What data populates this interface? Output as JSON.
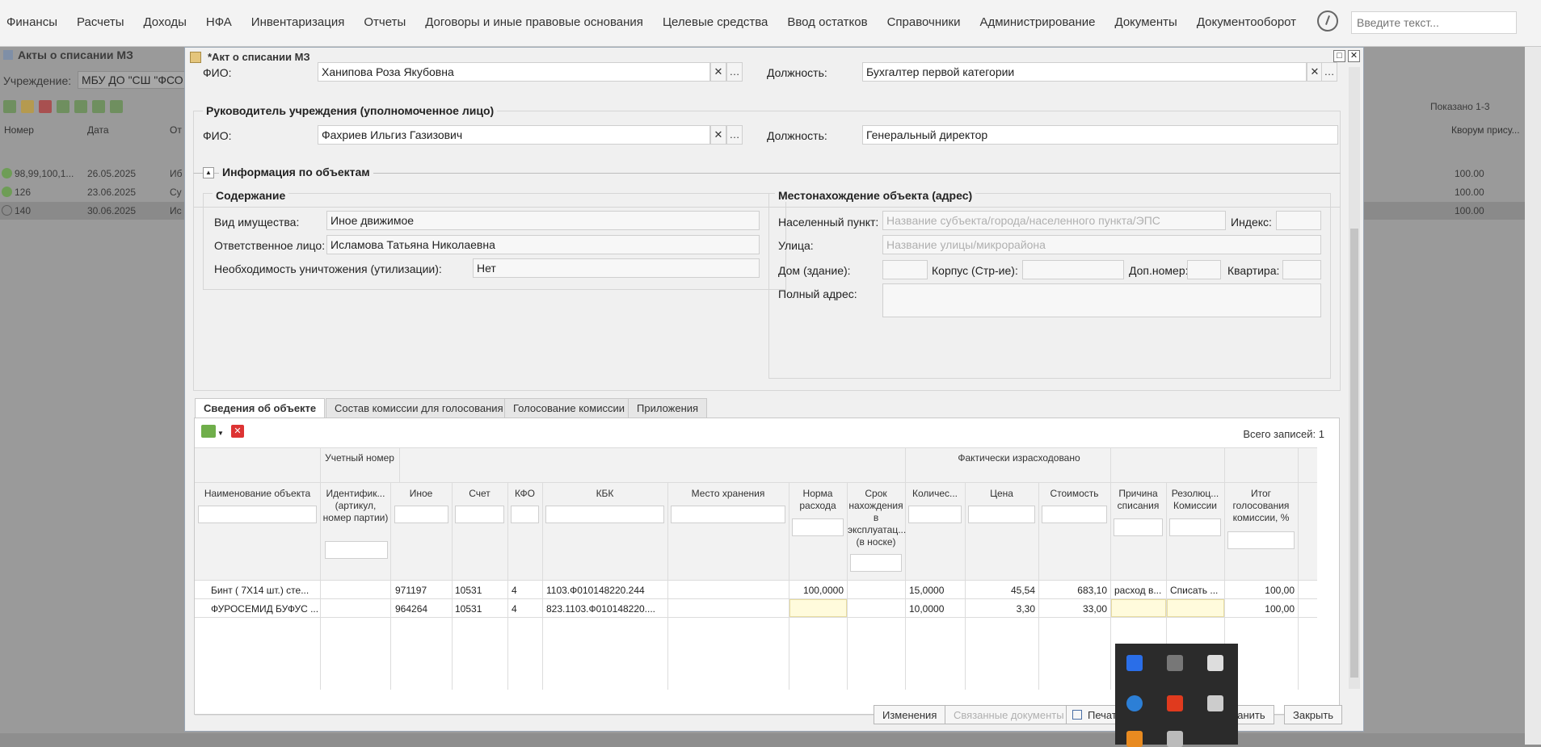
{
  "menu": {
    "items": [
      "Финансы",
      "Расчеты",
      "Доходы",
      "НФА",
      "Инвентаризация",
      "Отчеты",
      "Договоры и иные правовые основания",
      "Целевые средства",
      "Ввод остатков",
      "Справочники",
      "Администрирование",
      "Документы",
      "Документооборот"
    ],
    "search_placeholder": "Введите текст..."
  },
  "background_list": {
    "title": "Акты о списании МЗ",
    "org_label": "Учреждение:",
    "org_value": "МБУ ДО \"СШ \"ФСО \"",
    "shown": "Показано 1-3",
    "columns": [
      "Номер",
      "Дата",
      "От",
      "Кворум прису..."
    ],
    "rows": [
      {
        "number": "98,99,100,1...",
        "date": "26.05.2025",
        "from": "Иб",
        "quorum": "100.00"
      },
      {
        "number": "126",
        "date": "23.06.2025",
        "from": "Су",
        "quorum": "100.00"
      },
      {
        "number": "140",
        "date": "30.06.2025",
        "from": "Ис",
        "quorum": "100.00"
      }
    ]
  },
  "modal": {
    "title": "*Акт о списании МЗ",
    "accountant": {
      "fio_label": "ФИО:",
      "fio_value": "Ханипова Роза Якубовна",
      "position_label": "Должность:",
      "position_value": "Бухгалтер первой категории"
    },
    "head": {
      "group_label": "Руководитель учреждения (уполномоченное лицо)",
      "fio_label": "ФИО:",
      "fio_value": "Фахриев Ильгиз Газизович",
      "position_label": "Должность:",
      "position_value": "Генеральный директор"
    },
    "objects_section": {
      "title": "Информация по объектам",
      "content_title": "Содержание",
      "property_type_label": "Вид имущества:",
      "property_type_value": "Иное движимое",
      "responsible_label": "Ответственное лицо:",
      "responsible_value": "Исламова Татьяна Николаевна",
      "disposal_label": "Необходимость уничтожения (утилизации):",
      "disposal_value": "Нет",
      "location_title": "Местонахождение объекта (адрес)",
      "locality_label": "Населенный пункт:",
      "locality_placeholder": "Название субъекта/города/населенного пункта/ЭПС",
      "index_label": "Индекс:",
      "street_label": "Улица:",
      "street_placeholder": "Название улицы/микрорайона",
      "house_label": "Дом (здание):",
      "building_label": "Корпус (Стр-ие):",
      "extra_label": "Доп.номер:",
      "flat_label": "Квартира:",
      "full_address_label": "Полный адрес:"
    },
    "tabs": [
      "Сведения об объекте",
      "Состав комиссии для голосования",
      "Голосование комиссии",
      "Приложения"
    ],
    "grid": {
      "total": "Всего записей: 1",
      "group_headers": {
        "accounting_number": "Учетный номер",
        "actual_spent": "Фактически израсходовано"
      },
      "columns": [
        "Наименование объекта",
        "Идентифик... (артикул, номер партии)",
        "Иное",
        "Счет",
        "КФО",
        "КБК",
        "Место хранения",
        "Норма расхода",
        "Срок нахождения в эксплуатац... (в носке)",
        "Количес...",
        "Цена",
        "Стоимость",
        "Причина списания",
        "Резолюц... Комиссии",
        "Итог голосования комиссии, %"
      ],
      "rows": [
        {
          "name": "Бинт ( 7Х14 шт.) сте...",
          "ident": "",
          "other": "971197",
          "account": "10531",
          "kfo": "4",
          "kbk": "1103.Ф010148220.244",
          "storage": "",
          "norm": "100,0000",
          "term": "",
          "qty": "15,0000",
          "price": "45,54",
          "cost": "683,10",
          "reason": "расход в...",
          "resolution": "Списать ...",
          "result": "100,00"
        },
        {
          "name": "ФУРОСЕМИД БУФУС ...",
          "ident": "",
          "other": "964264",
          "account": "10531",
          "kfo": "4",
          "kbk": "823.1103.Ф010148220....",
          "storage": "",
          "norm": "",
          "term": "",
          "qty": "10,0000",
          "price": "3,30",
          "cost": "33,00",
          "reason": "",
          "resolution": "",
          "result": "100,00"
        }
      ]
    },
    "buttons": {
      "changes": "Изменения",
      "related": "Связанные документы",
      "print": "Печать",
      "save": "ранить",
      "close": "Закрыть"
    }
  }
}
